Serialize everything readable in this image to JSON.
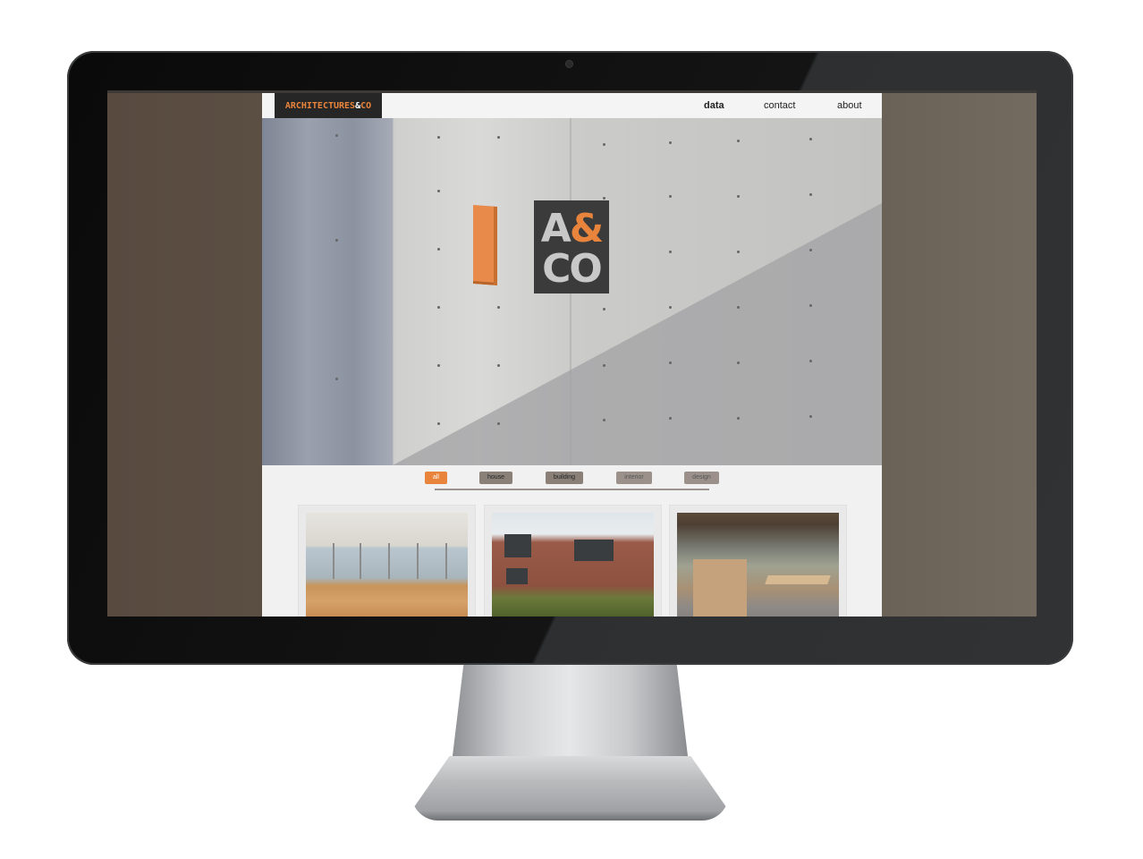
{
  "site": {
    "logo": {
      "part1": "ARCHITECTURES",
      "part2": "&",
      "part3": "CO"
    },
    "nav": [
      {
        "label": "data",
        "active": true
      },
      {
        "label": "contact",
        "active": false
      },
      {
        "label": "about",
        "active": false
      }
    ],
    "hero": {
      "badge_line1_a": "A",
      "badge_line1_amp": "&",
      "badge_line2": "CO"
    },
    "filters": [
      {
        "label": "all",
        "active": true
      },
      {
        "label": "house",
        "active": false
      },
      {
        "label": "building",
        "active": false
      },
      {
        "label": "interior",
        "active": false
      },
      {
        "label": "design",
        "active": false
      }
    ],
    "cards": [
      {
        "image": "interior-hall-wood-floor-photo"
      },
      {
        "image": "brick-house-garden-photo"
      },
      {
        "image": "kitchen-interior-photo"
      }
    ]
  },
  "colors": {
    "accent": "#e8843c",
    "logo_bg": "#262626",
    "filter_inactive": "#8a8078",
    "page_bg": "#f1f1f1"
  }
}
